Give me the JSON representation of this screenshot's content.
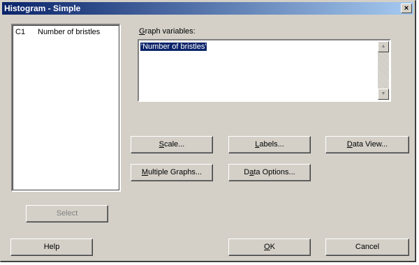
{
  "window": {
    "title": "Histogram - Simple",
    "close_label": "×"
  },
  "variable_list": {
    "items": [
      {
        "column": "C1",
        "name": "Number of bristles"
      }
    ]
  },
  "graph_variables": {
    "label_mnemonic": "G",
    "label_rest": "raph variables:",
    "value": "'Number of bristles'"
  },
  "buttons": {
    "scale": {
      "mnemonic": "S",
      "rest": "cale..."
    },
    "labels": {
      "mnemonic": "L",
      "rest": "abels..."
    },
    "data_view": {
      "mnemonic": "D",
      "rest": "ata View..."
    },
    "multiple_graphs": {
      "mnemonic": "M",
      "rest": "ultiple Graphs..."
    },
    "data_options": {
      "pre": "D",
      "mnemonic": "a",
      "rest": "ta Options..."
    },
    "select": "Select",
    "help": "Help",
    "ok": {
      "mnemonic": "O",
      "rest": "K"
    },
    "cancel": "Cancel"
  },
  "icons": {
    "scroll_up": "scroll-up-arrow-icon",
    "scroll_down": "scroll-down-arrow-icon"
  },
  "colors": {
    "dialog_bg": "#d4d0c8",
    "title_gradient_start": "#0a246a",
    "title_gradient_end": "#a6caf0",
    "selection": "#0a246a"
  }
}
